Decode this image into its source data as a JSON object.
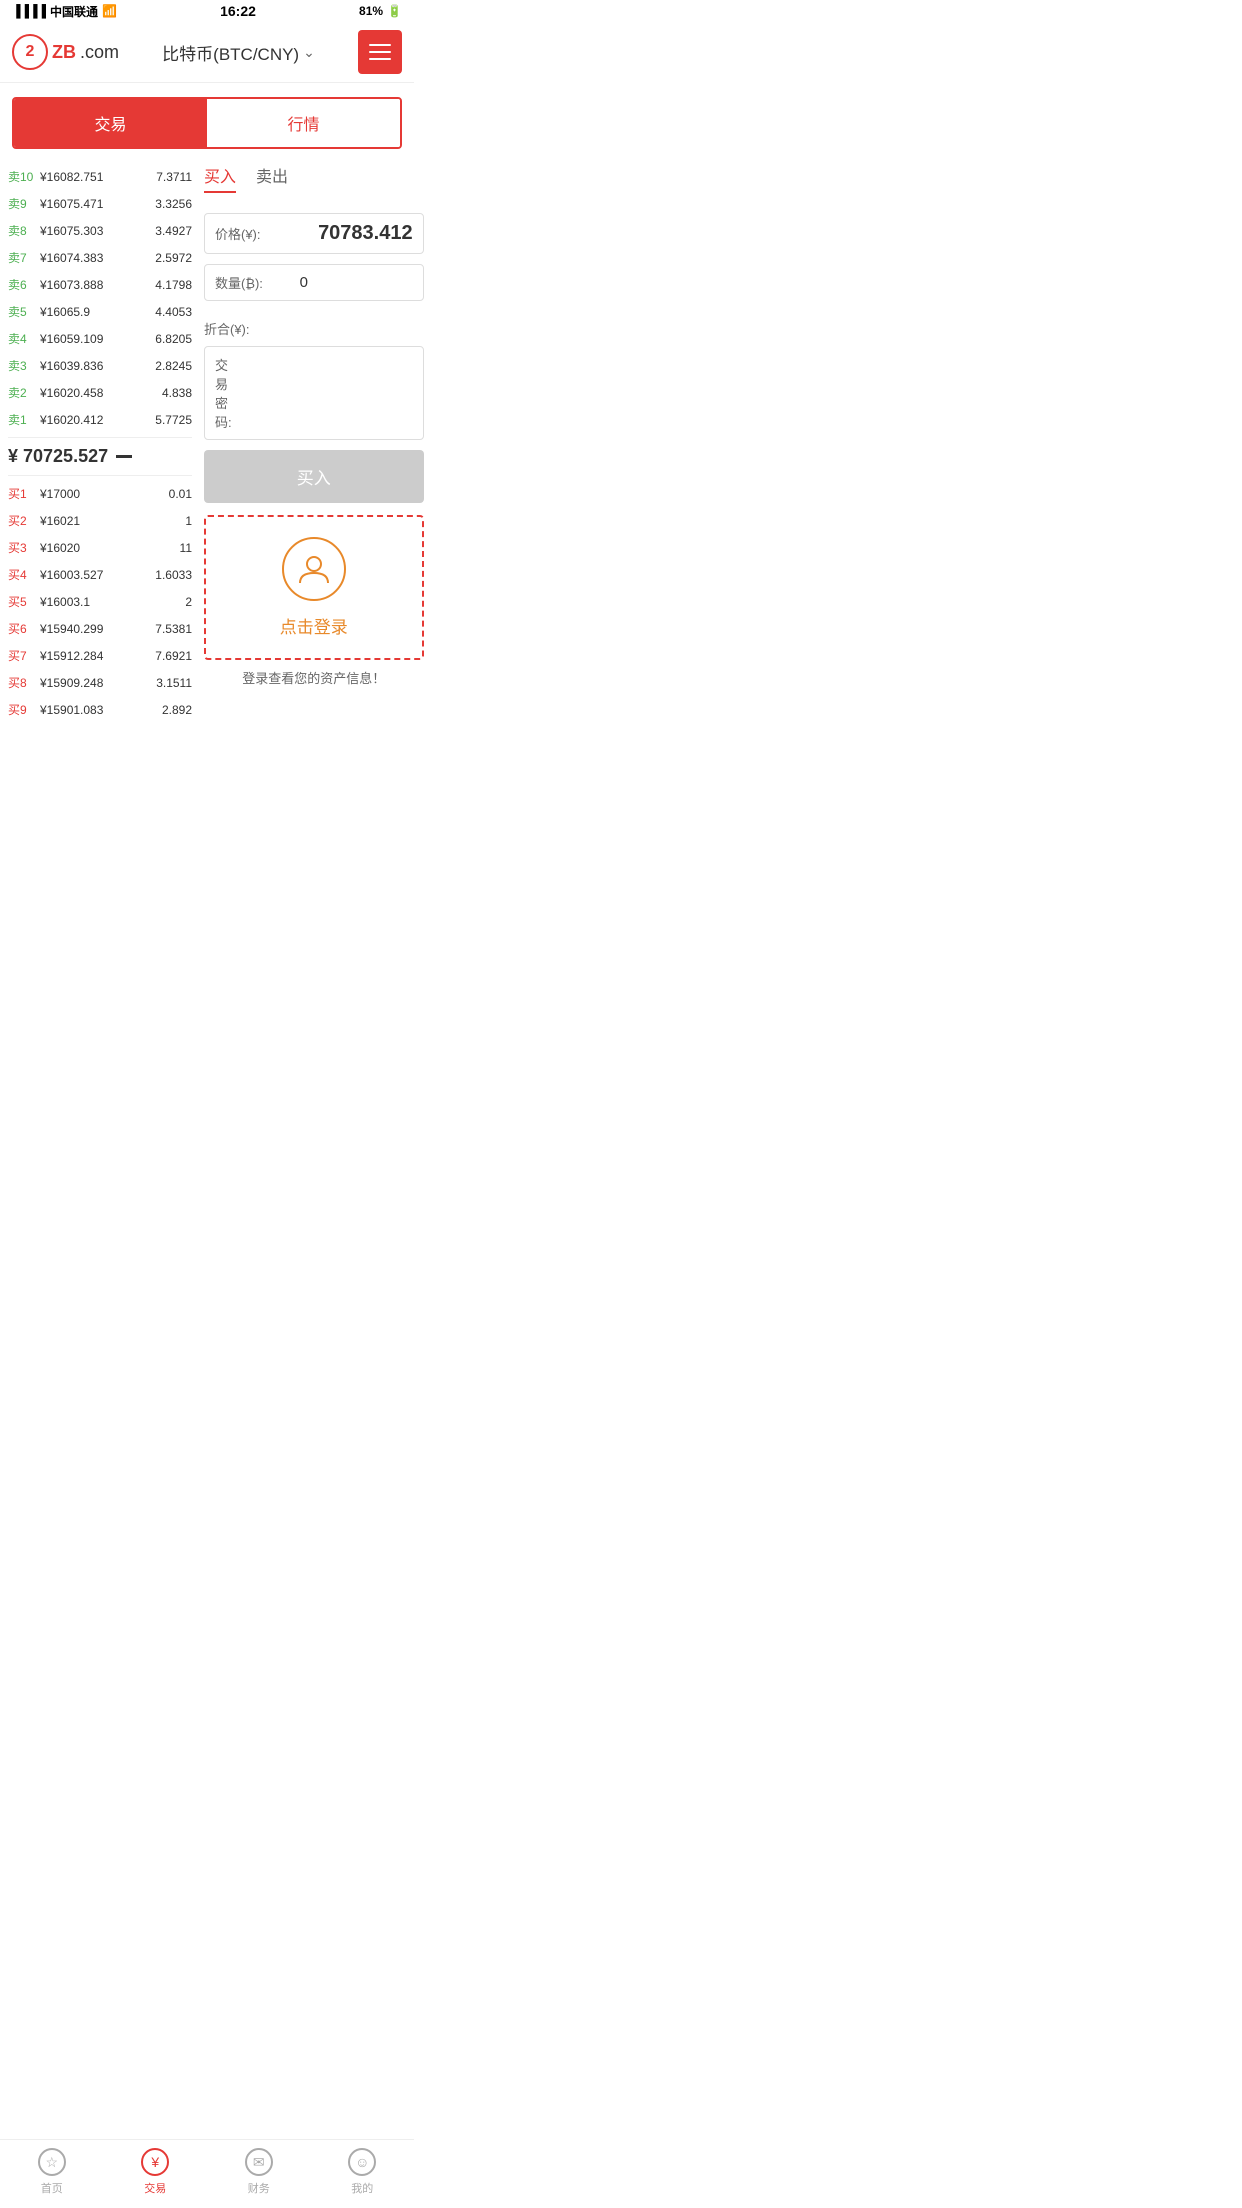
{
  "statusBar": {
    "carrier": "中国联通",
    "time": "16:22",
    "battery": "81%"
  },
  "header": {
    "logoText": "ZB",
    "logoDomain": ".com",
    "title": "比特币(BTC/CNY)",
    "menuLabel": "menu"
  },
  "mainTabs": {
    "tab1": "交易",
    "tab2": "行情"
  },
  "orderBook": {
    "sells": [
      {
        "label": "卖10",
        "price": "¥16082.751",
        "qty": "7.3711"
      },
      {
        "label": "卖9",
        "price": "¥16075.471",
        "qty": "3.3256"
      },
      {
        "label": "卖8",
        "price": "¥16075.303",
        "qty": "3.4927"
      },
      {
        "label": "卖7",
        "price": "¥16074.383",
        "qty": "2.5972"
      },
      {
        "label": "卖6",
        "price": "¥16073.888",
        "qty": "4.1798"
      },
      {
        "label": "卖5",
        "price": "¥16065.9",
        "qty": "4.4053"
      },
      {
        "label": "卖4",
        "price": "¥16059.109",
        "qty": "6.8205"
      },
      {
        "label": "卖3",
        "price": "¥16039.836",
        "qty": "2.8245"
      },
      {
        "label": "卖2",
        "price": "¥16020.458",
        "qty": "4.838"
      },
      {
        "label": "卖1",
        "price": "¥16020.412",
        "qty": "5.7725"
      }
    ],
    "midPrice": "¥ 70725.527",
    "buys": [
      {
        "label": "买1",
        "price": "¥17000",
        "qty": "0.01"
      },
      {
        "label": "买2",
        "price": "¥16021",
        "qty": "1"
      },
      {
        "label": "买3",
        "price": "¥16020",
        "qty": "11"
      },
      {
        "label": "买4",
        "price": "¥16003.527",
        "qty": "1.6033"
      },
      {
        "label": "买5",
        "price": "¥16003.1",
        "qty": "2"
      },
      {
        "label": "买6",
        "price": "¥15940.299",
        "qty": "7.5381"
      },
      {
        "label": "买7",
        "price": "¥15912.284",
        "qty": "7.6921"
      },
      {
        "label": "买8",
        "price": "¥15909.248",
        "qty": "3.1511"
      },
      {
        "label": "买9",
        "price": "¥15901.083",
        "qty": "2.892"
      }
    ]
  },
  "tradePanel": {
    "tab1": "买入",
    "tab2": "卖出",
    "priceLabel": "价格(¥):",
    "priceValue": "70783.412",
    "qtyLabel": "数量(₿):",
    "qtyValue": "0",
    "foldLabel": "折合(¥):",
    "passwordLabel": "交易密码:",
    "buyButton": "买入"
  },
  "loginPrompt": {
    "text": "点击登录",
    "desc": "登录查看您的资产信息！"
  },
  "bottomNav": {
    "item1": "首页",
    "item2": "交易",
    "item3": "财务",
    "item4": "我的"
  }
}
